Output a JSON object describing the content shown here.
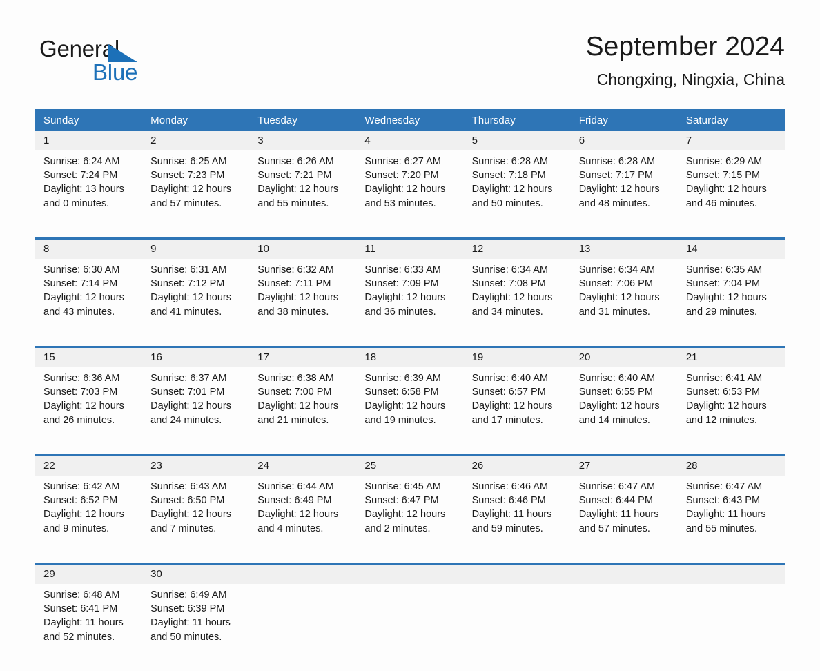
{
  "brand": {
    "name_part1": "General",
    "name_part2": "Blue",
    "logo_icon": "triangle-flag-icon"
  },
  "header": {
    "month_title": "September 2024",
    "location": "Chongxing, Ningxia, China"
  },
  "colors": {
    "header_blue": "#2e75b6",
    "brand_blue": "#1c70b8",
    "daynum_bg": "#f0f0f0",
    "page_bg": "#fdfdfd",
    "text": "#1a1a1a"
  },
  "calendar": {
    "weekday_headers": [
      "Sunday",
      "Monday",
      "Tuesday",
      "Wednesday",
      "Thursday",
      "Friday",
      "Saturday"
    ],
    "labels": {
      "sunrise": "Sunrise:",
      "sunset": "Sunset:",
      "daylight": "Daylight:"
    },
    "weeks": [
      {
        "days": [
          {
            "num": "1",
            "sunrise": "Sunrise: 6:24 AM",
            "sunset": "Sunset: 7:24 PM",
            "daylight_1": "Daylight: 13 hours",
            "daylight_2": "and 0 minutes."
          },
          {
            "num": "2",
            "sunrise": "Sunrise: 6:25 AM",
            "sunset": "Sunset: 7:23 PM",
            "daylight_1": "Daylight: 12 hours",
            "daylight_2": "and 57 minutes."
          },
          {
            "num": "3",
            "sunrise": "Sunrise: 6:26 AM",
            "sunset": "Sunset: 7:21 PM",
            "daylight_1": "Daylight: 12 hours",
            "daylight_2": "and 55 minutes."
          },
          {
            "num": "4",
            "sunrise": "Sunrise: 6:27 AM",
            "sunset": "Sunset: 7:20 PM",
            "daylight_1": "Daylight: 12 hours",
            "daylight_2": "and 53 minutes."
          },
          {
            "num": "5",
            "sunrise": "Sunrise: 6:28 AM",
            "sunset": "Sunset: 7:18 PM",
            "daylight_1": "Daylight: 12 hours",
            "daylight_2": "and 50 minutes."
          },
          {
            "num": "6",
            "sunrise": "Sunrise: 6:28 AM",
            "sunset": "Sunset: 7:17 PM",
            "daylight_1": "Daylight: 12 hours",
            "daylight_2": "and 48 minutes."
          },
          {
            "num": "7",
            "sunrise": "Sunrise: 6:29 AM",
            "sunset": "Sunset: 7:15 PM",
            "daylight_1": "Daylight: 12 hours",
            "daylight_2": "and 46 minutes."
          }
        ]
      },
      {
        "days": [
          {
            "num": "8",
            "sunrise": "Sunrise: 6:30 AM",
            "sunset": "Sunset: 7:14 PM",
            "daylight_1": "Daylight: 12 hours",
            "daylight_2": "and 43 minutes."
          },
          {
            "num": "9",
            "sunrise": "Sunrise: 6:31 AM",
            "sunset": "Sunset: 7:12 PM",
            "daylight_1": "Daylight: 12 hours",
            "daylight_2": "and 41 minutes."
          },
          {
            "num": "10",
            "sunrise": "Sunrise: 6:32 AM",
            "sunset": "Sunset: 7:11 PM",
            "daylight_1": "Daylight: 12 hours",
            "daylight_2": "and 38 minutes."
          },
          {
            "num": "11",
            "sunrise": "Sunrise: 6:33 AM",
            "sunset": "Sunset: 7:09 PM",
            "daylight_1": "Daylight: 12 hours",
            "daylight_2": "and 36 minutes."
          },
          {
            "num": "12",
            "sunrise": "Sunrise: 6:34 AM",
            "sunset": "Sunset: 7:08 PM",
            "daylight_1": "Daylight: 12 hours",
            "daylight_2": "and 34 minutes."
          },
          {
            "num": "13",
            "sunrise": "Sunrise: 6:34 AM",
            "sunset": "Sunset: 7:06 PM",
            "daylight_1": "Daylight: 12 hours",
            "daylight_2": "and 31 minutes."
          },
          {
            "num": "14",
            "sunrise": "Sunrise: 6:35 AM",
            "sunset": "Sunset: 7:04 PM",
            "daylight_1": "Daylight: 12 hours",
            "daylight_2": "and 29 minutes."
          }
        ]
      },
      {
        "days": [
          {
            "num": "15",
            "sunrise": "Sunrise: 6:36 AM",
            "sunset": "Sunset: 7:03 PM",
            "daylight_1": "Daylight: 12 hours",
            "daylight_2": "and 26 minutes."
          },
          {
            "num": "16",
            "sunrise": "Sunrise: 6:37 AM",
            "sunset": "Sunset: 7:01 PM",
            "daylight_1": "Daylight: 12 hours",
            "daylight_2": "and 24 minutes."
          },
          {
            "num": "17",
            "sunrise": "Sunrise: 6:38 AM",
            "sunset": "Sunset: 7:00 PM",
            "daylight_1": "Daylight: 12 hours",
            "daylight_2": "and 21 minutes."
          },
          {
            "num": "18",
            "sunrise": "Sunrise: 6:39 AM",
            "sunset": "Sunset: 6:58 PM",
            "daylight_1": "Daylight: 12 hours",
            "daylight_2": "and 19 minutes."
          },
          {
            "num": "19",
            "sunrise": "Sunrise: 6:40 AM",
            "sunset": "Sunset: 6:57 PM",
            "daylight_1": "Daylight: 12 hours",
            "daylight_2": "and 17 minutes."
          },
          {
            "num": "20",
            "sunrise": "Sunrise: 6:40 AM",
            "sunset": "Sunset: 6:55 PM",
            "daylight_1": "Daylight: 12 hours",
            "daylight_2": "and 14 minutes."
          },
          {
            "num": "21",
            "sunrise": "Sunrise: 6:41 AM",
            "sunset": "Sunset: 6:53 PM",
            "daylight_1": "Daylight: 12 hours",
            "daylight_2": "and 12 minutes."
          }
        ]
      },
      {
        "days": [
          {
            "num": "22",
            "sunrise": "Sunrise: 6:42 AM",
            "sunset": "Sunset: 6:52 PM",
            "daylight_1": "Daylight: 12 hours",
            "daylight_2": "and 9 minutes."
          },
          {
            "num": "23",
            "sunrise": "Sunrise: 6:43 AM",
            "sunset": "Sunset: 6:50 PM",
            "daylight_1": "Daylight: 12 hours",
            "daylight_2": "and 7 minutes."
          },
          {
            "num": "24",
            "sunrise": "Sunrise: 6:44 AM",
            "sunset": "Sunset: 6:49 PM",
            "daylight_1": "Daylight: 12 hours",
            "daylight_2": "and 4 minutes."
          },
          {
            "num": "25",
            "sunrise": "Sunrise: 6:45 AM",
            "sunset": "Sunset: 6:47 PM",
            "daylight_1": "Daylight: 12 hours",
            "daylight_2": "and 2 minutes."
          },
          {
            "num": "26",
            "sunrise": "Sunrise: 6:46 AM",
            "sunset": "Sunset: 6:46 PM",
            "daylight_1": "Daylight: 11 hours",
            "daylight_2": "and 59 minutes."
          },
          {
            "num": "27",
            "sunrise": "Sunrise: 6:47 AM",
            "sunset": "Sunset: 6:44 PM",
            "daylight_1": "Daylight: 11 hours",
            "daylight_2": "and 57 minutes."
          },
          {
            "num": "28",
            "sunrise": "Sunrise: 6:47 AM",
            "sunset": "Sunset: 6:43 PM",
            "daylight_1": "Daylight: 11 hours",
            "daylight_2": "and 55 minutes."
          }
        ]
      },
      {
        "days": [
          {
            "num": "29",
            "sunrise": "Sunrise: 6:48 AM",
            "sunset": "Sunset: 6:41 PM",
            "daylight_1": "Daylight: 11 hours",
            "daylight_2": "and 52 minutes."
          },
          {
            "num": "30",
            "sunrise": "Sunrise: 6:49 AM",
            "sunset": "Sunset: 6:39 PM",
            "daylight_1": "Daylight: 11 hours",
            "daylight_2": "and 50 minutes."
          },
          {
            "num": "",
            "sunrise": "",
            "sunset": "",
            "daylight_1": "",
            "daylight_2": ""
          },
          {
            "num": "",
            "sunrise": "",
            "sunset": "",
            "daylight_1": "",
            "daylight_2": ""
          },
          {
            "num": "",
            "sunrise": "",
            "sunset": "",
            "daylight_1": "",
            "daylight_2": ""
          },
          {
            "num": "",
            "sunrise": "",
            "sunset": "",
            "daylight_1": "",
            "daylight_2": ""
          },
          {
            "num": "",
            "sunrise": "",
            "sunset": "",
            "daylight_1": "",
            "daylight_2": ""
          }
        ]
      }
    ]
  }
}
